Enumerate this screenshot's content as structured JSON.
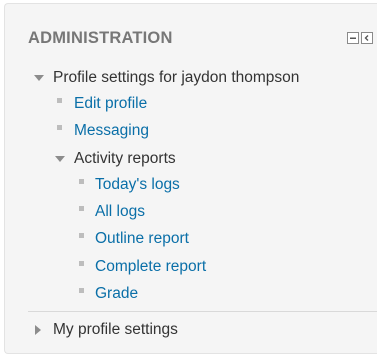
{
  "block": {
    "title": "ADMINISTRATION",
    "controls": [
      {
        "icon": "minus-icon",
        "label": "Hide block"
      },
      {
        "icon": "dock-arrow-icon",
        "label": "Dock block"
      }
    ]
  },
  "tree": {
    "profile_settings_node": {
      "label": "Profile settings for jaydon thompson",
      "icon": "triangle-down-icon",
      "items": [
        {
          "label": "Edit profile",
          "icon": "bullet-square-icon"
        },
        {
          "label": "Messaging",
          "icon": "bullet-square-icon"
        }
      ],
      "activity_reports_node": {
        "label": "Activity reports",
        "icon": "triangle-down-icon",
        "items": [
          {
            "label": "Today's logs",
            "icon": "bullet-square-icon"
          },
          {
            "label": "All logs",
            "icon": "bullet-square-icon"
          },
          {
            "label": "Outline report",
            "icon": "bullet-square-icon"
          },
          {
            "label": "Complete report",
            "icon": "bullet-square-icon"
          },
          {
            "label": "Grade",
            "icon": "bullet-square-icon"
          }
        ]
      }
    },
    "my_profile_settings_node": {
      "label": "My profile settings",
      "icon": "triangle-right-icon"
    }
  },
  "colors": {
    "link": "#0a6fa8",
    "text": "#333333",
    "title": "#777777",
    "block_background": "#f5f5f5"
  }
}
